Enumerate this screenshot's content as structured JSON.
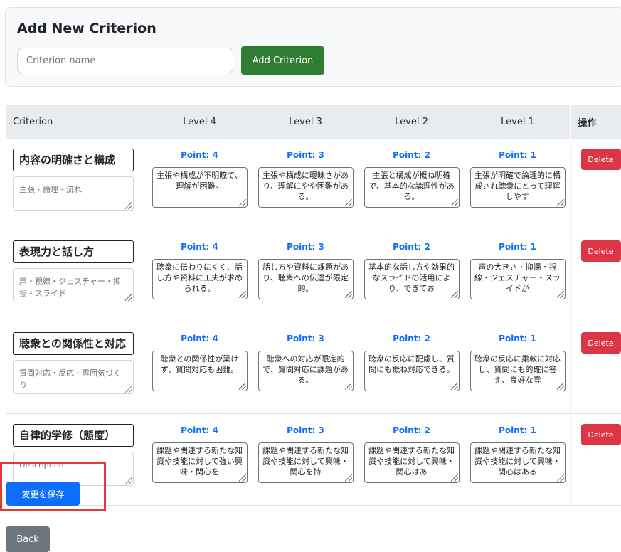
{
  "add_section": {
    "title": "Add New Criterion",
    "input_placeholder": "Criterion name",
    "button_label": "Add Criterion"
  },
  "table": {
    "headers": [
      "Criterion",
      "Level 4",
      "Level 3",
      "Level 2",
      "Level 1",
      "操作"
    ],
    "rows": [
      {
        "name": "内容の明確さと構成",
        "description": "主張・論理・流れ",
        "description_is_placeholder": false,
        "levels": [
          {
            "point": "Point: 4",
            "text": "主張や構成が不明瞭で、理解が困難。"
          },
          {
            "point": "Point: 3",
            "text": "主張や構成に曖昧さがあり、理解にやや困難がある。"
          },
          {
            "point": "Point: 2",
            "text": "主張と構成が概ね明確で、基本的な論理性がある。"
          },
          {
            "point": "Point: 1",
            "text": "主張が明確で論理的に構成され聴衆にとって理解しやす"
          }
        ],
        "delete_label": "Delete"
      },
      {
        "name": "表現力と話し方",
        "description": "声・視線・ジェスチャー・抑揚・スライド",
        "description_is_placeholder": false,
        "levels": [
          {
            "point": "Point: 4",
            "text": "聴衆に伝わりにくく、話し方や資料に工夫が求められる。"
          },
          {
            "point": "Point: 3",
            "text": "話し方や資料に課題があり、聴衆への伝達が限定的。"
          },
          {
            "point": "Point: 2",
            "text": "基本的な話し方や効果的なスライドの活用により、できてお"
          },
          {
            "point": "Point: 1",
            "text": "声の大きさ・抑揚・視線・ジェスチャー・スライドが"
          }
        ],
        "delete_label": "Delete"
      },
      {
        "name": "聴衆との関係性と対応",
        "description": "質問対応・反応・雰囲気づくり",
        "description_is_placeholder": false,
        "levels": [
          {
            "point": "Point: 4",
            "text": "聴衆との関係性が築けず、質問対応も困難。"
          },
          {
            "point": "Point: 3",
            "text": "聴衆への対応が限定的で、質問対応に課題がある。"
          },
          {
            "point": "Point: 2",
            "text": "聴衆の反応に配慮し、質問にも概ね対応できる。"
          },
          {
            "point": "Point: 1",
            "text": "聴衆の反応に柔軟に対応し、質問にも的確に答え、良好な雰"
          }
        ],
        "delete_label": "Delete"
      },
      {
        "name": "自律的学修（態度）",
        "description": "Description",
        "description_is_placeholder": true,
        "levels": [
          {
            "point": "Point: 4",
            "text": "課題や関連する新たな知識や技能に対して強い興味・関心を"
          },
          {
            "point": "Point: 3",
            "text": "課題や関連する新たな知識や技能に対して興味・関心を持"
          },
          {
            "point": "Point: 2",
            "text": "課題や関連する新たな知識や技能に対して興味・関心はあ"
          },
          {
            "point": "Point: 1",
            "text": "課題や関連する新たな知識や技能に対して興味・関心はある"
          }
        ],
        "delete_label": "Delete"
      }
    ]
  },
  "save_button": "変更を保存",
  "back_button": "Back"
}
